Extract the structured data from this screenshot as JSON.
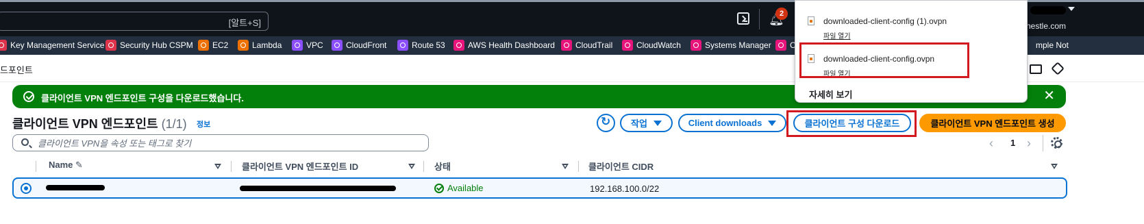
{
  "topbar": {
    "search_shortcut": "[알트+S]",
    "notification_count": "2",
    "region_text": "nestle.com"
  },
  "favorites": [
    {
      "label": "Key Management Service",
      "color": "#dd344c"
    },
    {
      "label": "Security Hub CSPM",
      "color": "#dd344c"
    },
    {
      "label": "EC2",
      "color": "#ed7100"
    },
    {
      "label": "Lambda",
      "color": "#ed7100"
    },
    {
      "label": "VPC",
      "color": "#8c4fff"
    },
    {
      "label": "CloudFront",
      "color": "#8c4fff"
    },
    {
      "label": "Route 53",
      "color": "#8c4fff"
    },
    {
      "label": "AWS Health Dashboard",
      "color": "#e7157b"
    },
    {
      "label": "CloudTrail",
      "color": "#e7157b"
    },
    {
      "label": "CloudWatch",
      "color": "#e7157b"
    },
    {
      "label": "Systems Manager",
      "color": "#e7157b"
    },
    {
      "label": "C",
      "color": "#e7157b"
    },
    {
      "label": "mple Not",
      "color": "#e7157b"
    }
  ],
  "breadcrumb": "드포인트",
  "flash": {
    "message": "클라이언트 VPN 엔드포인트 구성을 다운로드했습니다.",
    "close_label": "✕"
  },
  "table": {
    "title": "클라이언트 VPN 엔드포인트",
    "count": "(1/1)",
    "info_link": "정보",
    "actions_label": "작업",
    "client_downloads_label": "Client downloads",
    "download_config_label": "클라이언트 구성 다운로드",
    "create_label": "클라이언트 VPN 엔드포인트 생성",
    "filter_placeholder": "클라이언트 VPN을 속성 또는 태그로 찾기",
    "page_prev": "‹",
    "page_number": "1",
    "page_next": "›",
    "columns": [
      "Name",
      "클라이언트 VPN 엔드포인트 ID",
      "상태",
      "클라이언트 CIDR"
    ],
    "rows": [
      {
        "name": "",
        "endpoint_id": "",
        "status": "Available",
        "cidr": "192.168.100.0/22"
      }
    ]
  },
  "downloads_popup": {
    "items": [
      {
        "filename": "downloaded-client-config (1).ovpn",
        "action": "파일 열기"
      },
      {
        "filename": "downloaded-client-config.ovpn",
        "action": "파일 열기"
      }
    ],
    "see_more": "자세히 보기"
  },
  "colors": {
    "accent": "#0972d3",
    "success": "#037f0c",
    "primary_button": "#ff9900",
    "highlight_box": "#d31920"
  }
}
